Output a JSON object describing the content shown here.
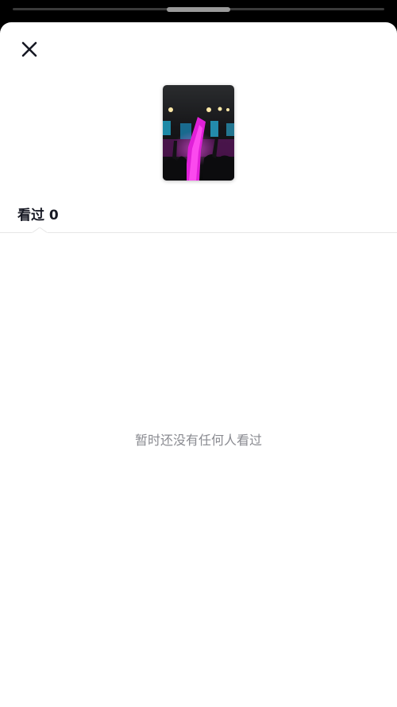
{
  "viewer_sheet": {
    "seen_tab_label": "看过",
    "seen_count": "0",
    "empty_message": "暂时还没有任何人看过"
  },
  "colors": {
    "sheet_background": "#ffffff",
    "title_text": "#161823",
    "muted_text": "#8a8b91",
    "divider": "#e6e6e6",
    "thumbnail_accent": "#e020d8"
  },
  "icons": {
    "close": "close-icon",
    "story_thumbnail": "concert-photo-thumbnail"
  }
}
